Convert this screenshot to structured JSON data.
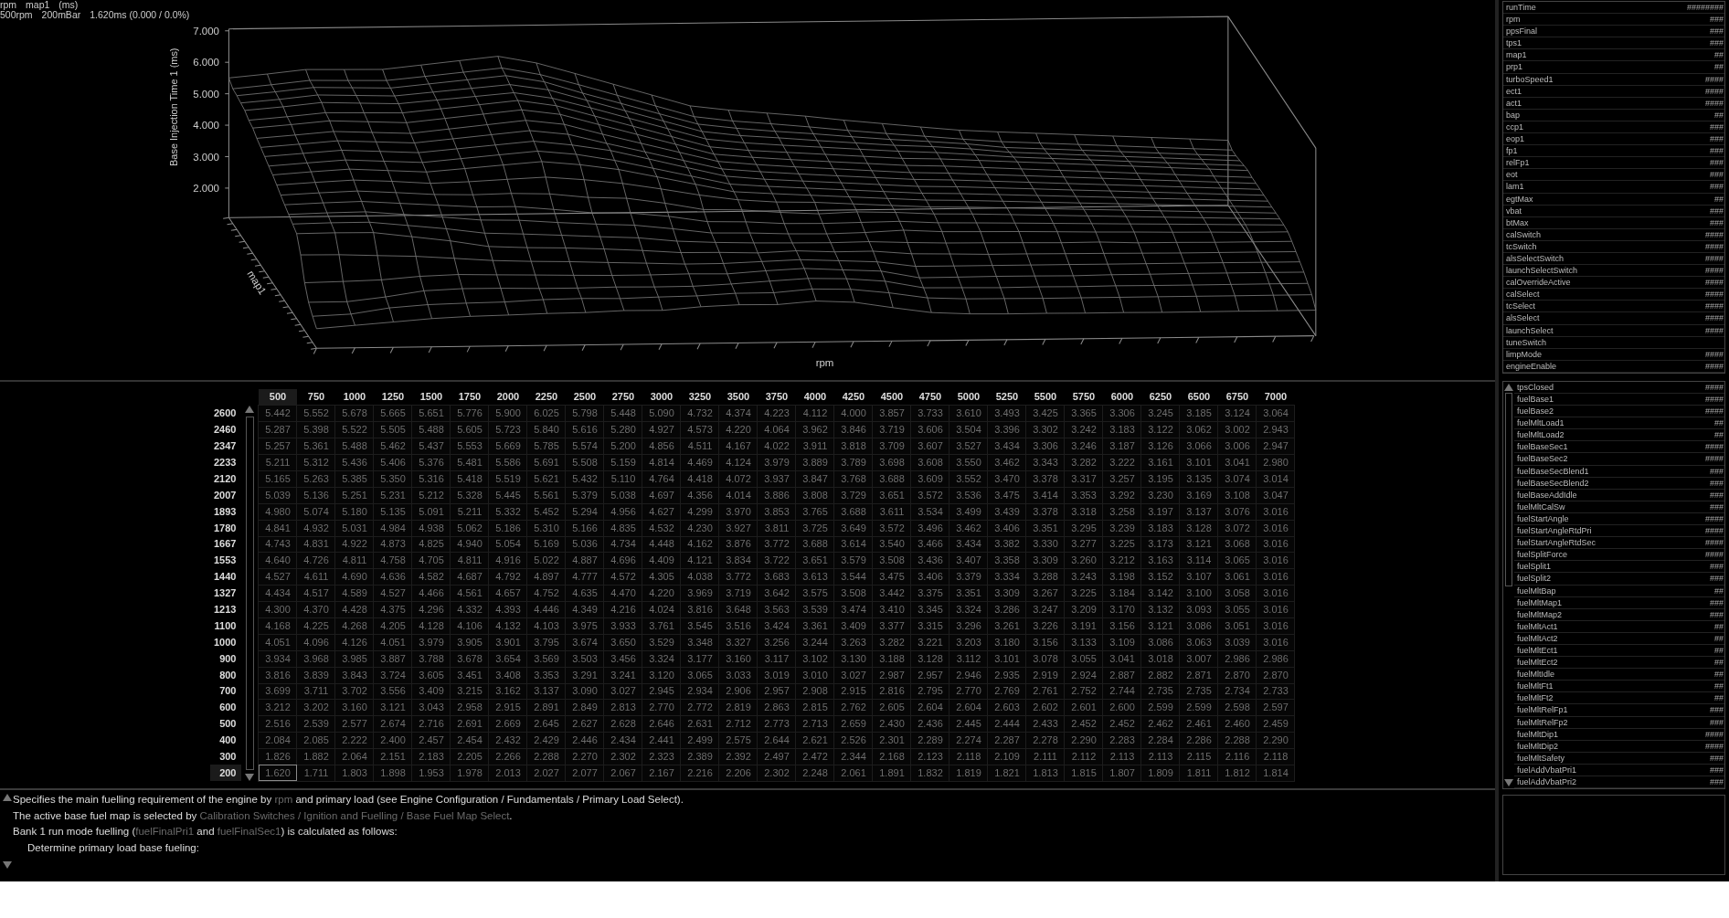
{
  "chart_header": {
    "axis_labels": [
      "rpm",
      "map1",
      "(ms)"
    ],
    "cursor_readout": [
      "500rpm",
      "200mBar",
      "1.620ms (0.000 / 0.0%)"
    ]
  },
  "surface_plot": {
    "z_axis_title": "Base Injection Time 1 (ms)",
    "z_ticks": [
      "7.000",
      "6.000",
      "5.000",
      "4.000",
      "3.000",
      "2.000"
    ],
    "depth_axis_title": "map1",
    "x_axis_title": "rpm"
  },
  "table": {
    "columns": [
      {
        "label": "500",
        "selected": true
      },
      {
        "label": "750",
        "selected": false
      },
      {
        "label": "1000",
        "selected": false
      },
      {
        "label": "1250",
        "selected": false
      },
      {
        "label": "1500",
        "selected": false
      },
      {
        "label": "1750",
        "selected": false
      },
      {
        "label": "2000",
        "selected": false
      },
      {
        "label": "2250",
        "selected": false
      },
      {
        "label": "2500",
        "selected": false
      },
      {
        "label": "2750",
        "selected": false
      },
      {
        "label": "3000",
        "selected": false
      },
      {
        "label": "3250",
        "selected": false
      },
      {
        "label": "3500",
        "selected": false
      },
      {
        "label": "3750",
        "selected": false
      },
      {
        "label": "4000",
        "selected": false
      },
      {
        "label": "4250",
        "selected": false
      },
      {
        "label": "4500",
        "selected": false
      },
      {
        "label": "4750",
        "selected": false
      },
      {
        "label": "5000",
        "selected": false
      },
      {
        "label": "5250",
        "selected": false
      },
      {
        "label": "5500",
        "selected": false
      },
      {
        "label": "5750",
        "selected": false
      },
      {
        "label": "6000",
        "selected": false
      },
      {
        "label": "6250",
        "selected": false
      },
      {
        "label": "6500",
        "selected": false
      },
      {
        "label": "6750",
        "selected": false
      },
      {
        "label": "7000",
        "selected": false
      }
    ],
    "rows": [
      {
        "label": "2600",
        "selected": false,
        "cells": [
          "5.442",
          "5.552",
          "5.678",
          "5.665",
          "5.651",
          "5.776",
          "5.900",
          "6.025",
          "5.798",
          "5.448",
          "5.090",
          "4.732",
          "4.374",
          "4.223",
          "4.112",
          "4.000",
          "3.857",
          "3.733",
          "3.610",
          "3.493",
          "3.425",
          "3.365",
          "3.306",
          "3.245",
          "3.185",
          "3.124",
          "3.064"
        ]
      },
      {
        "label": "2460",
        "selected": false,
        "cells": [
          "5.287",
          "5.398",
          "5.522",
          "5.505",
          "5.488",
          "5.605",
          "5.723",
          "5.840",
          "5.616",
          "5.280",
          "4.927",
          "4.573",
          "4.220",
          "4.064",
          "3.962",
          "3.846",
          "3.719",
          "3.606",
          "3.504",
          "3.396",
          "3.302",
          "3.242",
          "3.183",
          "3.122",
          "3.062",
          "3.002",
          "2.943"
        ]
      },
      {
        "label": "2347",
        "selected": false,
        "cells": [
          "5.257",
          "5.361",
          "5.488",
          "5.462",
          "5.437",
          "5.553",
          "5.669",
          "5.785",
          "5.574",
          "5.200",
          "4.856",
          "4.511",
          "4.167",
          "4.022",
          "3.911",
          "3.818",
          "3.709",
          "3.607",
          "3.527",
          "3.434",
          "3.306",
          "3.246",
          "3.187",
          "3.126",
          "3.066",
          "3.006",
          "2.947"
        ]
      },
      {
        "label": "2233",
        "selected": false,
        "cells": [
          "5.211",
          "5.312",
          "5.436",
          "5.406",
          "5.376",
          "5.481",
          "5.586",
          "5.691",
          "5.508",
          "5.159",
          "4.814",
          "4.469",
          "4.124",
          "3.979",
          "3.889",
          "3.789",
          "3.698",
          "3.608",
          "3.550",
          "3.462",
          "3.343",
          "3.282",
          "3.222",
          "3.161",
          "3.101",
          "3.041",
          "2.980"
        ]
      },
      {
        "label": "2120",
        "selected": false,
        "cells": [
          "5.165",
          "5.263",
          "5.385",
          "5.350",
          "5.316",
          "5.418",
          "5.519",
          "5.621",
          "5.432",
          "5.110",
          "4.764",
          "4.418",
          "4.072",
          "3.937",
          "3.847",
          "3.768",
          "3.688",
          "3.609",
          "3.552",
          "3.470",
          "3.378",
          "3.317",
          "3.257",
          "3.195",
          "3.135",
          "3.074",
          "3.014"
        ]
      },
      {
        "label": "2007",
        "selected": false,
        "cells": [
          "5.039",
          "5.136",
          "5.251",
          "5.231",
          "5.212",
          "5.328",
          "5.445",
          "5.561",
          "5.379",
          "5.038",
          "4.697",
          "4.356",
          "4.014",
          "3.886",
          "3.808",
          "3.729",
          "3.651",
          "3.572",
          "3.536",
          "3.475",
          "3.414",
          "3.353",
          "3.292",
          "3.230",
          "3.169",
          "3.108",
          "3.047"
        ]
      },
      {
        "label": "1893",
        "selected": false,
        "cells": [
          "4.980",
          "5.074",
          "5.180",
          "5.135",
          "5.091",
          "5.211",
          "5.332",
          "5.452",
          "5.294",
          "4.956",
          "4.627",
          "4.299",
          "3.970",
          "3.853",
          "3.765",
          "3.688",
          "3.611",
          "3.534",
          "3.499",
          "3.439",
          "3.378",
          "3.318",
          "3.258",
          "3.197",
          "3.137",
          "3.076",
          "3.016"
        ]
      },
      {
        "label": "1780",
        "selected": false,
        "cells": [
          "4.841",
          "4.932",
          "5.031",
          "4.984",
          "4.938",
          "5.062",
          "5.186",
          "5.310",
          "5.166",
          "4.835",
          "4.532",
          "4.230",
          "3.927",
          "3.811",
          "3.725",
          "3.649",
          "3.572",
          "3.496",
          "3.462",
          "3.406",
          "3.351",
          "3.295",
          "3.239",
          "3.183",
          "3.128",
          "3.072",
          "3.016"
        ]
      },
      {
        "label": "1667",
        "selected": false,
        "cells": [
          "4.743",
          "4.831",
          "4.922",
          "4.873",
          "4.825",
          "4.940",
          "5.054",
          "5.169",
          "5.036",
          "4.734",
          "4.448",
          "4.162",
          "3.876",
          "3.772",
          "3.688",
          "3.614",
          "3.540",
          "3.466",
          "3.434",
          "3.382",
          "3.330",
          "3.277",
          "3.225",
          "3.173",
          "3.121",
          "3.068",
          "3.016"
        ]
      },
      {
        "label": "1553",
        "selected": false,
        "cells": [
          "4.640",
          "4.726",
          "4.811",
          "4.758",
          "4.705",
          "4.811",
          "4.916",
          "5.022",
          "4.887",
          "4.696",
          "4.409",
          "4.121",
          "3.834",
          "3.722",
          "3.651",
          "3.579",
          "3.508",
          "3.436",
          "3.407",
          "3.358",
          "3.309",
          "3.260",
          "3.212",
          "3.163",
          "3.114",
          "3.065",
          "3.016"
        ]
      },
      {
        "label": "1440",
        "selected": false,
        "cells": [
          "4.527",
          "4.611",
          "4.690",
          "4.636",
          "4.582",
          "4.687",
          "4.792",
          "4.897",
          "4.777",
          "4.572",
          "4.305",
          "4.038",
          "3.772",
          "3.683",
          "3.613",
          "3.544",
          "3.475",
          "3.406",
          "3.379",
          "3.334",
          "3.288",
          "3.243",
          "3.198",
          "3.152",
          "3.107",
          "3.061",
          "3.016"
        ]
      },
      {
        "label": "1327",
        "selected": false,
        "cells": [
          "4.434",
          "4.517",
          "4.589",
          "4.527",
          "4.466",
          "4.561",
          "4.657",
          "4.752",
          "4.635",
          "4.470",
          "4.220",
          "3.969",
          "3.719",
          "3.642",
          "3.575",
          "3.508",
          "3.442",
          "3.375",
          "3.351",
          "3.309",
          "3.267",
          "3.225",
          "3.184",
          "3.142",
          "3.100",
          "3.058",
          "3.016"
        ]
      },
      {
        "label": "1213",
        "selected": false,
        "cells": [
          "4.300",
          "4.370",
          "4.428",
          "4.375",
          "4.296",
          "4.332",
          "4.393",
          "4.446",
          "4.349",
          "4.216",
          "4.024",
          "3.816",
          "3.648",
          "3.563",
          "3.539",
          "3.474",
          "3.410",
          "3.345",
          "3.324",
          "3.286",
          "3.247",
          "3.209",
          "3.170",
          "3.132",
          "3.093",
          "3.055",
          "3.016"
        ]
      },
      {
        "label": "1100",
        "selected": false,
        "cells": [
          "4.168",
          "4.225",
          "4.268",
          "4.205",
          "4.128",
          "4.106",
          "4.132",
          "4.103",
          "3.975",
          "3.933",
          "3.761",
          "3.545",
          "3.516",
          "3.424",
          "3.361",
          "3.409",
          "3.377",
          "3.315",
          "3.296",
          "3.261",
          "3.226",
          "3.191",
          "3.156",
          "3.121",
          "3.086",
          "3.051",
          "3.016"
        ]
      },
      {
        "label": "1000",
        "selected": false,
        "cells": [
          "4.051",
          "4.096",
          "4.126",
          "4.051",
          "3.979",
          "3.905",
          "3.901",
          "3.795",
          "3.674",
          "3.650",
          "3.529",
          "3.348",
          "3.327",
          "3.256",
          "3.244",
          "3.263",
          "3.282",
          "3.221",
          "3.203",
          "3.180",
          "3.156",
          "3.133",
          "3.109",
          "3.086",
          "3.063",
          "3.039",
          "3.016"
        ]
      },
      {
        "label": "900",
        "selected": false,
        "cells": [
          "3.934",
          "3.968",
          "3.985",
          "3.887",
          "3.788",
          "3.678",
          "3.654",
          "3.569",
          "3.503",
          "3.456",
          "3.324",
          "3.177",
          "3.160",
          "3.117",
          "3.102",
          "3.130",
          "3.188",
          "3.128",
          "3.112",
          "3.101",
          "3.078",
          "3.055",
          "3.041",
          "3.018",
          "3.007",
          "2.986",
          "2.986"
        ]
      },
      {
        "label": "800",
        "selected": false,
        "cells": [
          "3.816",
          "3.839",
          "3.843",
          "3.724",
          "3.605",
          "3.451",
          "3.408",
          "3.353",
          "3.291",
          "3.241",
          "3.120",
          "3.065",
          "3.033",
          "3.019",
          "3.010",
          "3.027",
          "2.987",
          "2.957",
          "2.946",
          "2.935",
          "2.919",
          "2.924",
          "2.887",
          "2.882",
          "2.871",
          "2.870",
          "2.870"
        ]
      },
      {
        "label": "700",
        "selected": false,
        "cells": [
          "3.699",
          "3.711",
          "3.702",
          "3.556",
          "3.409",
          "3.215",
          "3.162",
          "3.137",
          "3.090",
          "3.027",
          "2.945",
          "2.934",
          "2.906",
          "2.957",
          "2.908",
          "2.915",
          "2.816",
          "2.795",
          "2.770",
          "2.769",
          "2.761",
          "2.752",
          "2.744",
          "2.735",
          "2.735",
          "2.734",
          "2.733"
        ]
      },
      {
        "label": "600",
        "selected": false,
        "cells": [
          "3.212",
          "3.202",
          "3.160",
          "3.121",
          "3.043",
          "2.958",
          "2.915",
          "2.891",
          "2.849",
          "2.813",
          "2.770",
          "2.772",
          "2.819",
          "2.863",
          "2.815",
          "2.762",
          "2.605",
          "2.604",
          "2.604",
          "2.603",
          "2.602",
          "2.601",
          "2.600",
          "2.599",
          "2.599",
          "2.598",
          "2.597"
        ]
      },
      {
        "label": "500",
        "selected": false,
        "cells": [
          "2.516",
          "2.539",
          "2.577",
          "2.674",
          "2.716",
          "2.691",
          "2.669",
          "2.645",
          "2.627",
          "2.628",
          "2.646",
          "2.631",
          "2.712",
          "2.773",
          "2.713",
          "2.659",
          "2.430",
          "2.436",
          "2.445",
          "2.444",
          "2.433",
          "2.452",
          "2.452",
          "2.462",
          "2.461",
          "2.460",
          "2.459"
        ]
      },
      {
        "label": "400",
        "selected": false,
        "cells": [
          "2.084",
          "2.085",
          "2.222",
          "2.400",
          "2.457",
          "2.454",
          "2.432",
          "2.429",
          "2.446",
          "2.434",
          "2.441",
          "2.499",
          "2.575",
          "2.644",
          "2.621",
          "2.526",
          "2.301",
          "2.289",
          "2.274",
          "2.287",
          "2.278",
          "2.290",
          "2.283",
          "2.284",
          "2.286",
          "2.288",
          "2.290"
        ]
      },
      {
        "label": "300",
        "selected": false,
        "cells": [
          "1.826",
          "1.882",
          "2.064",
          "2.151",
          "2.183",
          "2.205",
          "2.266",
          "2.288",
          "2.270",
          "2.302",
          "2.323",
          "2.389",
          "2.392",
          "2.497",
          "2.472",
          "2.344",
          "2.168",
          "2.123",
          "2.118",
          "2.109",
          "2.111",
          "2.112",
          "2.113",
          "2.113",
          "2.115",
          "2.116",
          "2.118"
        ]
      },
      {
        "label": "200",
        "selected": true,
        "cells": [
          "1.620",
          "1.711",
          "1.803",
          "1.898",
          "1.953",
          "1.978",
          "2.013",
          "2.027",
          "2.077",
          "2.067",
          "2.167",
          "2.216",
          "2.206",
          "2.302",
          "2.248",
          "2.061",
          "1.891",
          "1.832",
          "1.819",
          "1.821",
          "1.813",
          "1.815",
          "1.807",
          "1.809",
          "1.811",
          "1.812",
          "1.814"
        ]
      }
    ]
  },
  "help": {
    "lines": [
      {
        "kind": "paragraph",
        "segments": [
          {
            "kind": "text",
            "text": "Specifies the main fuelling requirement of the engine by "
          },
          {
            "kind": "ref",
            "text": "rpm"
          },
          {
            "kind": "text",
            "text": " and primary load (see Engine Configuration / Fundamentals / Primary Load Select)."
          }
        ]
      },
      {
        "kind": "paragraph",
        "segments": [
          {
            "kind": "text",
            "text": "The active base fuel map is selected by "
          },
          {
            "kind": "ref",
            "text": "Calibration Switches / Ignition and Fuelling / Base Fuel Map Select"
          },
          {
            "kind": "text",
            "text": "."
          }
        ]
      },
      {
        "kind": "paragraph",
        "segments": [
          {
            "kind": "text",
            "text": "Bank 1 run mode fuelling ("
          },
          {
            "kind": "ref",
            "text": "fuelFinalPri1"
          },
          {
            "kind": "text",
            "text": " and "
          },
          {
            "kind": "ref",
            "text": "fuelFinalSec1"
          },
          {
            "kind": "text",
            "text": ") is calculated as follows:"
          }
        ]
      },
      {
        "kind": "step",
        "segments": [
          {
            "kind": "text",
            "text": "Determine primary load base fueling:"
          }
        ]
      }
    ]
  },
  "channels_top": [
    {
      "name": "runTime",
      "value": "########"
    },
    {
      "name": "rpm",
      "value": "###"
    },
    {
      "name": "ppsFinal",
      "value": "###"
    },
    {
      "name": "tps1",
      "value": "###"
    },
    {
      "name": "map1",
      "value": "##"
    },
    {
      "name": "prp1",
      "value": "##"
    },
    {
      "name": "turboSpeed1",
      "value": "####"
    },
    {
      "name": "ect1",
      "value": "####"
    },
    {
      "name": "act1",
      "value": "####"
    },
    {
      "name": "bap",
      "value": "##"
    },
    {
      "name": "ccp1",
      "value": "###"
    },
    {
      "name": "eop1",
      "value": "###"
    },
    {
      "name": "fp1",
      "value": "###"
    },
    {
      "name": "relFp1",
      "value": "###"
    },
    {
      "name": "eot",
      "value": "###"
    },
    {
      "name": "lam1",
      "value": "###"
    },
    {
      "name": "egtMax",
      "value": "##"
    },
    {
      "name": "vbat",
      "value": "###"
    },
    {
      "name": "btMax",
      "value": "###"
    },
    {
      "name": "calSwitch",
      "value": "####"
    },
    {
      "name": "tcSwitch",
      "value": "####"
    },
    {
      "name": "alsSelectSwitch",
      "value": "####"
    },
    {
      "name": "launchSelectSwitch",
      "value": "####"
    },
    {
      "name": "calOverrideActive",
      "value": "####"
    },
    {
      "name": "calSelect",
      "value": "####"
    },
    {
      "name": "tcSelect",
      "value": "####"
    },
    {
      "name": "alsSelect",
      "value": "####"
    },
    {
      "name": "launchSelect",
      "value": "####"
    },
    {
      "name": "tuneSwitch"
    },
    {
      "name": "limpMode",
      "value": "####"
    },
    {
      "name": "engineEnable",
      "value": "####"
    }
  ],
  "channels_bottom": [
    {
      "name": "tpsClosed",
      "value": "####"
    },
    {
      "name": "fuelBase1",
      "value": "####"
    },
    {
      "name": "fuelBase2",
      "value": "####"
    },
    {
      "name": "fuelMltLoad1",
      "value": "##"
    },
    {
      "name": "fuelMltLoad2",
      "value": "##"
    },
    {
      "name": "fuelBaseSec1",
      "value": "####"
    },
    {
      "name": "fuelBaseSec2",
      "value": "####"
    },
    {
      "name": "fuelBaseSecBlend1",
      "value": "###"
    },
    {
      "name": "fuelBaseSecBlend2",
      "value": "###"
    },
    {
      "name": "fuelBaseAddIdle",
      "value": "###"
    },
    {
      "name": "fuelMltCalSw",
      "value": "###"
    },
    {
      "name": "fuelStartAngle",
      "value": "####"
    },
    {
      "name": "fuelStartAngleRtdPri",
      "value": "####"
    },
    {
      "name": "fuelStartAngleRtdSec",
      "value": "####"
    },
    {
      "name": "fuelSplitForce",
      "value": "####"
    },
    {
      "name": "fuelSplit1",
      "value": "###"
    },
    {
      "name": "fuelSplit2",
      "value": "###"
    },
    {
      "name": "fuelMltBap",
      "value": "##"
    },
    {
      "name": "fuelMltMap1",
      "value": "###"
    },
    {
      "name": "fuelMltMap2",
      "value": "###"
    },
    {
      "name": "fuelMltAct1",
      "value": "##"
    },
    {
      "name": "fuelMltAct2",
      "value": "##"
    },
    {
      "name": "fuelMltEct1",
      "value": "##"
    },
    {
      "name": "fuelMltEct2",
      "value": "##"
    },
    {
      "name": "fuelMltIdle",
      "value": "##"
    },
    {
      "name": "fuelMltFt1",
      "value": "##"
    },
    {
      "name": "fuelMltFt2",
      "value": "##"
    },
    {
      "name": "fuelMltRelFp1",
      "value": "###"
    },
    {
      "name": "fuelMltRelFp2",
      "value": "###"
    },
    {
      "name": "fuelMltDip1",
      "value": "####"
    },
    {
      "name": "fuelMltDip2",
      "value": "####"
    },
    {
      "name": "fuelMltSafety",
      "value": "###"
    },
    {
      "name": "fuelAddVbatPri1",
      "value": "###"
    },
    {
      "name": "fuelAddVbatPri2",
      "value": "###"
    }
  ]
}
